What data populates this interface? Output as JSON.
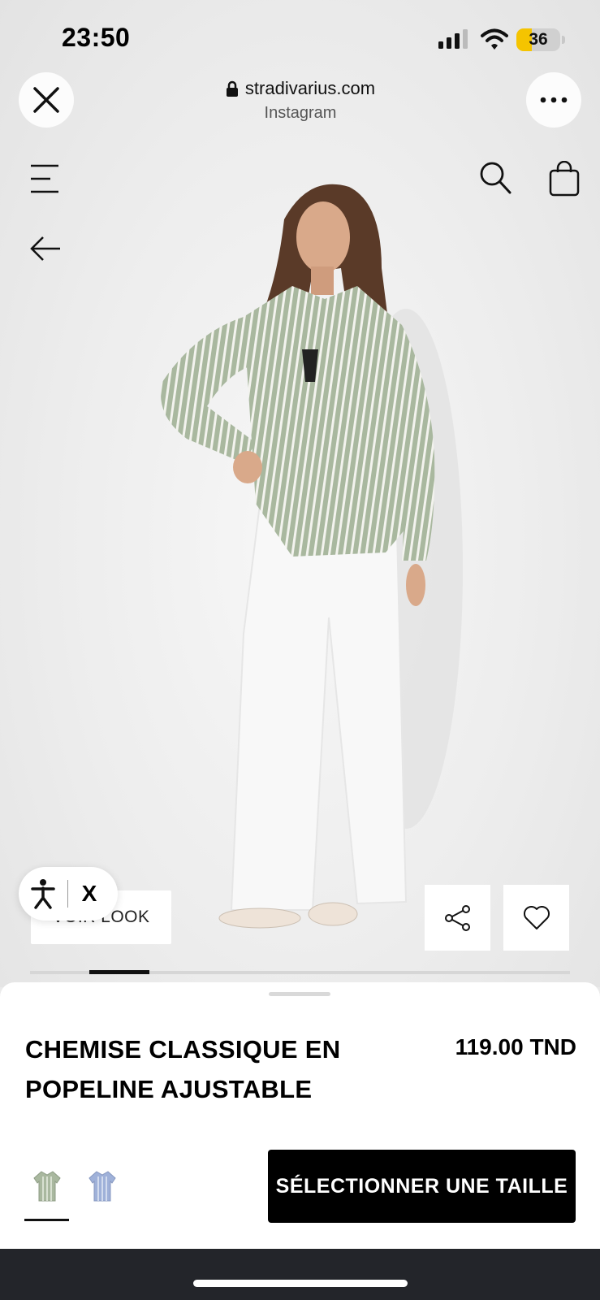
{
  "status_bar": {
    "time": "23:50",
    "battery_level": "36",
    "battery_color": "#f5c400"
  },
  "browser": {
    "domain": "stradivarius.com",
    "source_app": "Instagram",
    "icons": [
      "close-icon",
      "lock-icon",
      "more-icon"
    ]
  },
  "site_header": {
    "icons": [
      "menu-icon",
      "search-icon",
      "shopping-bag-icon",
      "back-arrow-icon"
    ]
  },
  "gallery": {
    "voir_look_label": "VOIR LOOK",
    "current_image": 2,
    "accessibility_close_label": "X"
  },
  "product": {
    "name": "CHEMISE CLASSIQUE EN POPELINE AJUSTABLE",
    "price": "119.00 TND",
    "colors": [
      {
        "name": "green-stripe",
        "hex": "#a9b89f",
        "selected": true
      },
      {
        "name": "blue-stripe",
        "hex": "#9fb1d9",
        "selected": false
      }
    ],
    "select_size_label": "SÉLECTIONNER UNE TAILLE"
  }
}
